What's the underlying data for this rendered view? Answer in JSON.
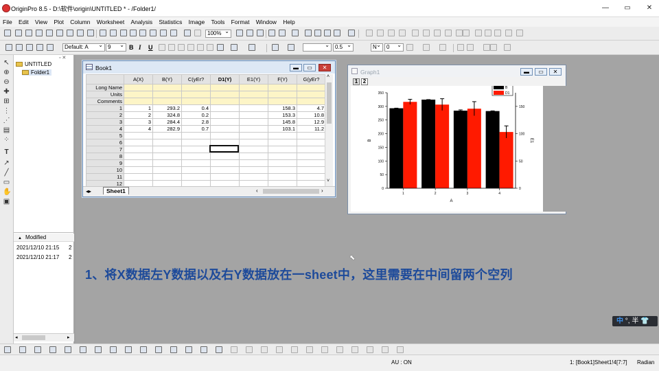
{
  "app": {
    "title": "OriginPro 8.5 - D:\\软件\\origin\\UNTITLED * - /Folder1/",
    "controls": [
      "—",
      "▭",
      "✕"
    ]
  },
  "menu": [
    "File",
    "Edit",
    "View",
    "Plot",
    "Column",
    "Worksheet",
    "Analysis",
    "Statistics",
    "Image",
    "Tools",
    "Format",
    "Window",
    "Help"
  ],
  "toolbar": {
    "zoom": "100%",
    "font_style": "Default: A",
    "font_size": "9",
    "line_style": "",
    "line_width": "0.5",
    "symbol_shape": "N",
    "symbol_size": "0"
  },
  "explorer": {
    "root": "UNTITLED",
    "folder": "Folder1",
    "column_header": "Modified",
    "rows": [
      {
        "modified": "2021/12/10 21:15",
        "count": "2"
      },
      {
        "modified": "2021/12/10 21:17",
        "count": "2"
      }
    ]
  },
  "book1": {
    "title": "Book1",
    "columns": [
      "A(X)",
      "B(Y)",
      "C(yEr?",
      "D1(Y)",
      "E1(Y)",
      "F(Y)",
      "G(yEr?"
    ],
    "meta_rows": [
      "Long Name",
      "Units",
      "Comments"
    ],
    "rows": [
      {
        "n": "1",
        "cells": [
          "1",
          "293.2",
          "0.4",
          "",
          "",
          "158.3",
          "4.7"
        ]
      },
      {
        "n": "2",
        "cells": [
          "2",
          "324.8",
          "0.2",
          "",
          "",
          "153.3",
          "10.8"
        ]
      },
      {
        "n": "3",
        "cells": [
          "3",
          "284.4",
          "2.8",
          "",
          "",
          "145.8",
          "12.9"
        ]
      },
      {
        "n": "4",
        "cells": [
          "4",
          "282.9",
          "0.7",
          "",
          "",
          "103.1",
          "11.2"
        ]
      },
      {
        "n": "5",
        "cells": [
          "",
          "",
          "",
          "",
          "",
          "",
          ""
        ]
      },
      {
        "n": "6",
        "cells": [
          "",
          "",
          "",
          "",
          "",
          "",
          ""
        ]
      },
      {
        "n": "7",
        "cells": [
          "",
          "",
          "",
          "",
          "",
          "",
          ""
        ]
      },
      {
        "n": "8",
        "cells": [
          "",
          "",
          "",
          "",
          "",
          "",
          ""
        ]
      },
      {
        "n": "9",
        "cells": [
          "",
          "",
          "",
          "",
          "",
          "",
          ""
        ]
      },
      {
        "n": "10",
        "cells": [
          "",
          "",
          "",
          "",
          "",
          "",
          ""
        ]
      },
      {
        "n": "11",
        "cells": [
          "",
          "",
          "",
          "",
          "",
          "",
          ""
        ]
      },
      {
        "n": "12",
        "cells": [
          "",
          "",
          "",
          "",
          "",
          "",
          ""
        ]
      }
    ],
    "sheet_tab": "Sheet1"
  },
  "graph1": {
    "title": "Graph1",
    "layers": [
      "1",
      "2"
    ]
  },
  "chart_data": {
    "type": "bar",
    "categories": [
      "1",
      "2",
      "3",
      "4"
    ],
    "xlabel": "A",
    "ylabel": "B",
    "y2label": "E1",
    "ylim": [
      0,
      350
    ],
    "y2lim": [
      0,
      175
    ],
    "yticks": [
      0,
      50,
      100,
      150,
      200,
      250,
      300,
      350
    ],
    "y2ticks": [
      0,
      50,
      100,
      150
    ],
    "legend_position": "top-right",
    "series": [
      {
        "name": "B",
        "axis": "left",
        "color": "#000000",
        "values": [
          293.2,
          324.8,
          284.4,
          282.9
        ],
        "errors": [
          0.4,
          0.2,
          2.8,
          0.7
        ]
      },
      {
        "name": "D1",
        "axis": "right",
        "color": "#ff1a00",
        "values": [
          158.3,
          153.3,
          145.8,
          103.1
        ],
        "errors": [
          4.7,
          10.8,
          12.9,
          11.2
        ]
      }
    ]
  },
  "caption": "1、将X数据左Y数据以及右Y数据放在一sheet中，这里需要在中间留两个空列",
  "ime": {
    "lang": "中",
    "rest": "°, 半 👕"
  },
  "status": {
    "au": "AU : ON",
    "ref": "1: [Book1]Sheet1!4[7:7]",
    "angle": "Radian"
  }
}
